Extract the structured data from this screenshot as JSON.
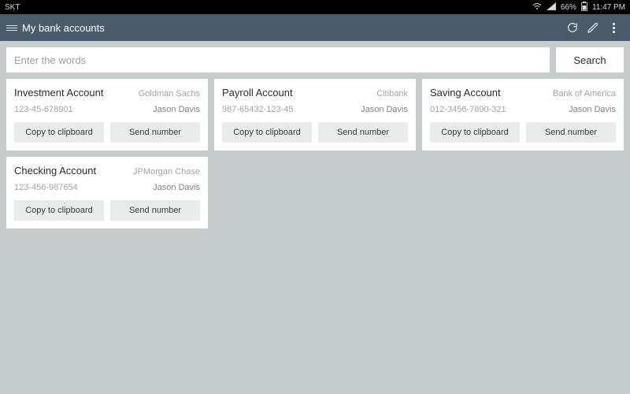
{
  "statusbar": {
    "carrier": "SKT",
    "battery": "66%",
    "time": "11:47 PM"
  },
  "appbar": {
    "title": "My bank accounts"
  },
  "search": {
    "placeholder": "Enter the words",
    "button": "Search"
  },
  "card_buttons": {
    "copy": "Copy to clipboard",
    "send": "Send number"
  },
  "accounts": [
    {
      "title": "Investment Account",
      "bank": "Goldman Sachs",
      "number": "123-45-678901",
      "owner": "Jason Davis"
    },
    {
      "title": "Payroll Account",
      "bank": "Citibank",
      "number": "987-65432-123-45",
      "owner": "Jason Davis"
    },
    {
      "title": "Saving Account",
      "bank": "Bank of America",
      "number": "012-3456-7890-321",
      "owner": "Jason Davis"
    },
    {
      "title": "Checking Account",
      "bank": "JPMorgan Chase",
      "number": "123-456-987654",
      "owner": "Jason Davis"
    }
  ]
}
